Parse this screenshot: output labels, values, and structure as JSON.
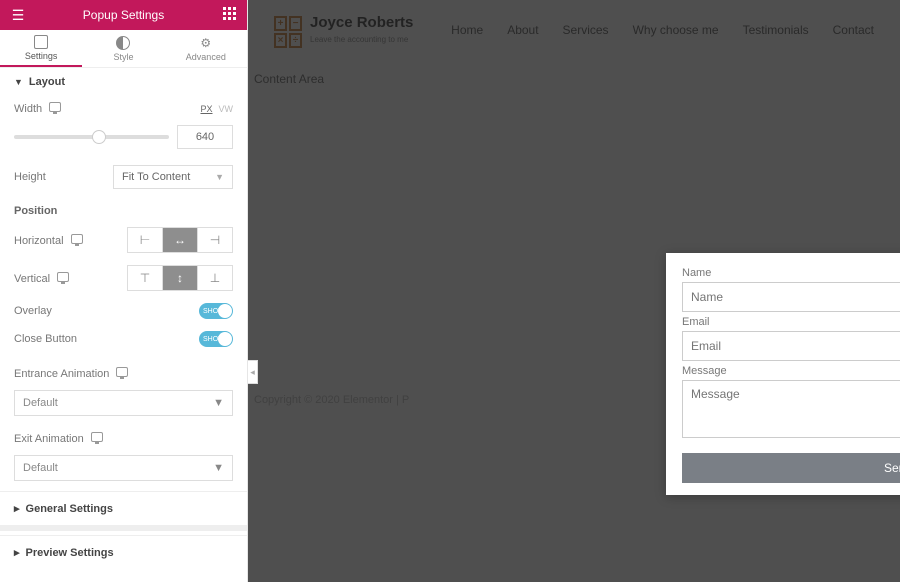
{
  "panel": {
    "title": "Popup Settings",
    "tabs": {
      "settings": "Settings",
      "style": "Style",
      "advanced": "Advanced"
    },
    "layout": {
      "heading": "Layout",
      "width_label": "Width",
      "units_px": "PX",
      "units_vw": "VW",
      "width_value": "640",
      "height_label": "Height",
      "height_value": "Fit To Content",
      "position_heading": "Position",
      "horizontal_label": "Horizontal",
      "vertical_label": "Vertical",
      "overlay_label": "Overlay",
      "overlay_toggle": "SHOW",
      "close_button_label": "Close Button",
      "close_button_toggle": "SHOW",
      "entrance_label": "Entrance Animation",
      "entrance_value": "Default",
      "exit_label": "Exit Animation",
      "exit_value": "Default"
    },
    "general_settings": "General Settings",
    "preview_settings": "Preview Settings"
  },
  "site": {
    "brand_name": "Joyce Roberts",
    "brand_tagline": "Leave the accounting to me",
    "logo_cells": [
      "+",
      "−",
      "×",
      "÷"
    ],
    "nav": [
      "Home",
      "About",
      "Services",
      "Why choose me",
      "Testimonials",
      "Contact"
    ],
    "content_placeholder": "Content Area",
    "footer": "Copyright © 2020 Elementor | P"
  },
  "popup": {
    "name_label": "Name",
    "name_placeholder": "Name",
    "email_label": "Email",
    "email_placeholder": "Email",
    "message_label": "Message",
    "message_placeholder": "Message",
    "send_label": "Send"
  }
}
